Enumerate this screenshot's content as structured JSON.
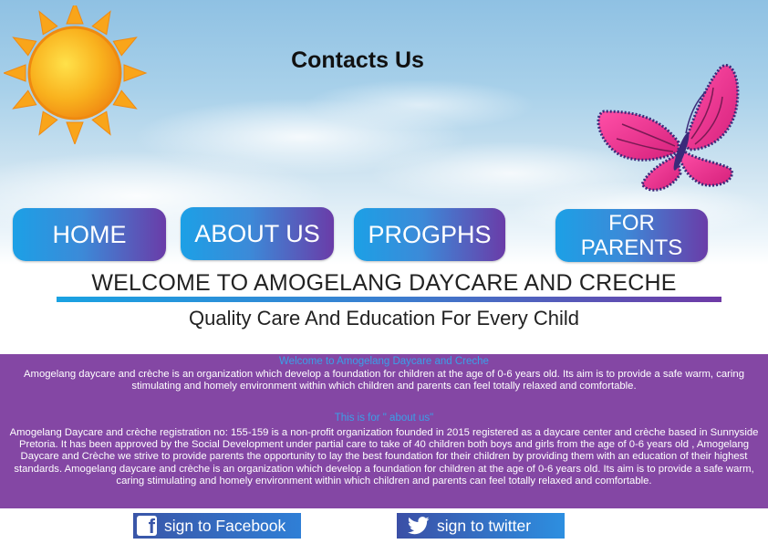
{
  "page": {
    "title": "Contacts  Us"
  },
  "nav": {
    "home_label": "HOME",
    "about_label": "ABOUT US",
    "progs_label": "PROGPHS",
    "parents_line1": "FOR",
    "parents_line2": "PARENTS"
  },
  "hero": {
    "heading": "WELCOME TO AMOGELANG DAYCARE AND CRECHE",
    "tagline": "Quality Care And Education For Every Child"
  },
  "panel": {
    "heading1": "Welcome to Amogelang Daycare and Creche",
    "paragraph1": "Amogelang daycare and crèche is an organization which develop a foundation for children at the age of 0-6 years old. Its aim is to provide a safe warm, caring stimulating and homely environment within which children and parents can feel totally relaxed and comfortable.",
    "heading2": "This is for \" about us\"",
    "paragraph2": "Amogelang Daycare and crèche registration no: 155-159 is a non-profit organization founded in 2015 registered as a daycare center and crèche based in Sunnyside Pretoria. It has been approved by the Social Development under partial care to take of 40 children both boys and girls from the age of 0-6 years old , Amogelang Daycare and Crèche we strive to provide parents the opportunity to lay the best foundation for their children by providing them with an education of their highest standards. Amogelang daycare and crèche is an organization which develop a foundation for children at the age of 0-6 years old. Its aim is to provide a safe warm, caring stimulating and homely environment within which children and parents can feel totally relaxed and comfortable."
  },
  "social": {
    "facebook_label": "sign to Facebook",
    "twitter_label": "sign to twitter"
  },
  "icons": {
    "sun": "sun-icon",
    "butterfly": "butterfly-icon",
    "facebook": "facebook-icon",
    "twitter": "twitter-icon"
  },
  "colors": {
    "panel_bg": "#8447a4",
    "panel_heading": "#3aa0e8",
    "nav_gradient_start": "#1ca0e6",
    "nav_gradient_end": "#6a3ca8",
    "sun_fill": "#f7a21c",
    "butterfly_fill": "#e8358f"
  }
}
